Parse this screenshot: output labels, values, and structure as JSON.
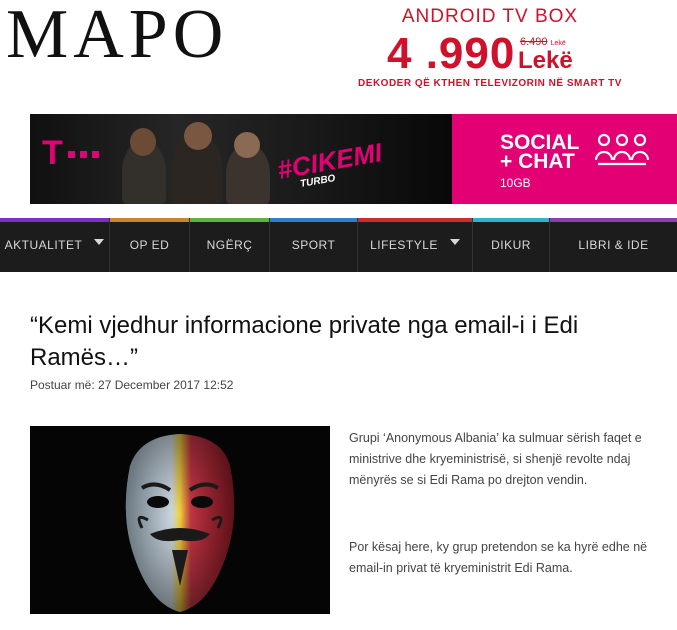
{
  "header": {
    "logo": "MAPO"
  },
  "top_ad": {
    "title": "ANDROID TV BOX",
    "price": "4 .990",
    "old_price": "6.490",
    "old_price_currency": "Lekë",
    "currency": "Lekë",
    "subtitle": "DEKODER QË KTHEN TELEVIZORIN NË SMART TV",
    "accent_color": "#d0112b"
  },
  "banner_ad": {
    "brand_mark": "T",
    "hashtag": "#CIKEMI",
    "tagline": "TURBO",
    "offer_line1": "SOCIAL",
    "offer_line2": "+ CHAT",
    "offer_detail": "10GB",
    "icon": "group-chat-icon",
    "brand_color": "#e20074"
  },
  "nav": {
    "items": [
      {
        "label": "AKTUALITET",
        "has_dropdown": true,
        "color": "#7b2fc9"
      },
      {
        "label": "OP ED",
        "has_dropdown": false,
        "color": "#c9842f"
      },
      {
        "label": "NGËRÇ",
        "has_dropdown": false,
        "color": "#5db33c"
      },
      {
        "label": "SPORT",
        "has_dropdown": false,
        "color": "#2f7fc9"
      },
      {
        "label": "LIFESTYLE",
        "has_dropdown": true,
        "color": "#c92f2f"
      },
      {
        "label": "DIKUR",
        "has_dropdown": false,
        "color": "#2fb5c9"
      },
      {
        "label": "LIBRI & IDE",
        "has_dropdown": false,
        "color": "#8a3fb0"
      }
    ]
  },
  "article": {
    "headline": "“Kemi vjedhur informacione private nga email-i i Edi Ramës…”",
    "posted": "Postuar më: 27 December 2017 12:52",
    "image_icon": "anonymous-mask-image",
    "paragraphs": [
      "Grupi ‘Anonymous Albania’ ka sulmuar sërish faqet e ministrive dhe kryeministrisë, si shenjë revolte ndaj mënyrës se si Edi Rama po drejton vendin.",
      "Por kësaj here, ky grup pretendon se ka hyrë edhe në email-in privat të kryeministrit Edi Rama."
    ]
  }
}
